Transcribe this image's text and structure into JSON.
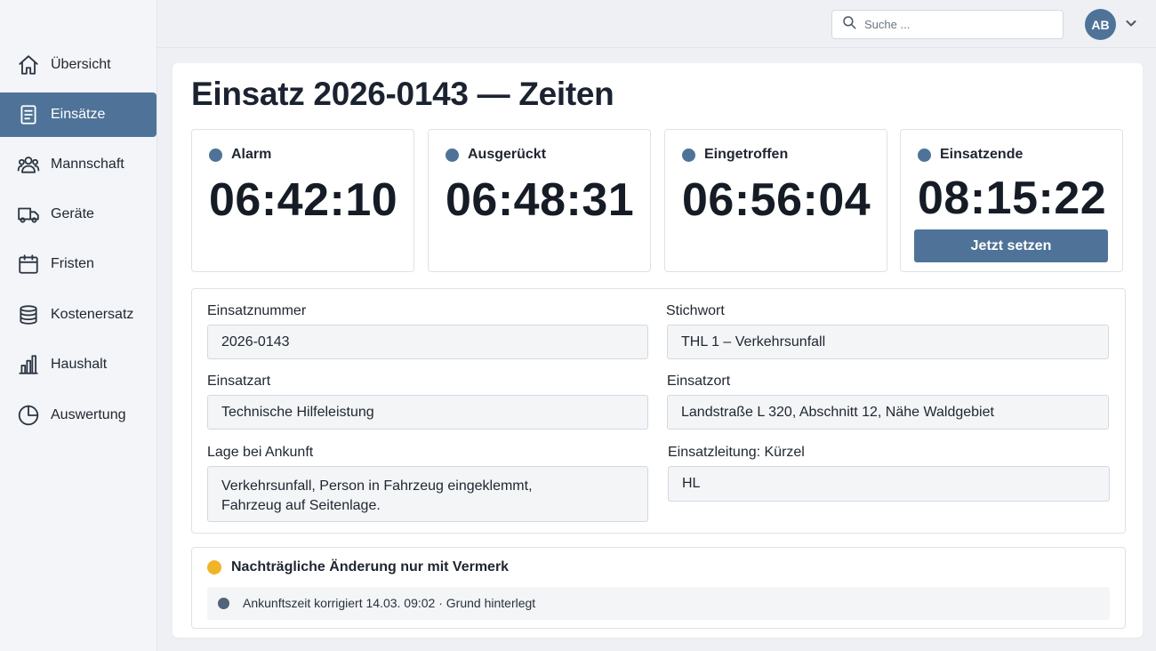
{
  "sidebar": {
    "items": [
      {
        "label": "Übersicht",
        "icon": "home-icon",
        "active": false
      },
      {
        "label": "Einsätze",
        "icon": "document-icon",
        "active": true
      },
      {
        "label": "Mannschaft",
        "icon": "users-icon",
        "active": false
      },
      {
        "label": "Geräte",
        "icon": "truck-icon",
        "active": false
      },
      {
        "label": "Fristen",
        "icon": "calendar-icon",
        "active": false
      },
      {
        "label": "Kostenersatz",
        "icon": "coins-icon",
        "active": false
      },
      {
        "label": "Haushalt",
        "icon": "bar-chart-icon",
        "active": false
      },
      {
        "label": "Auswertung",
        "icon": "pie-chart-icon",
        "active": false
      }
    ]
  },
  "topbar": {
    "search_placeholder": "Suche ...",
    "avatar_initials": "AB"
  },
  "page": {
    "title": "Einsatz 2026-0143 — Zeiten"
  },
  "times": [
    {
      "label": "Alarm",
      "value": "06:42:10"
    },
    {
      "label": "Ausgerückt",
      "value": "06:48:31"
    },
    {
      "label": "Eingetroffen",
      "value": "06:56:04"
    },
    {
      "label": "Einsatzende",
      "value": "08:15:22"
    }
  ],
  "set_now_label": "Jetzt setzen",
  "form": {
    "einsatznummer": {
      "label": "Einsatznummer",
      "value": "2026-0143"
    },
    "stichwort": {
      "label": "Stichwort",
      "value": "THL 1 – Verkehrsunfall"
    },
    "einsatzart": {
      "label": "Einsatzart",
      "value": "Technische Hilfeleistung"
    },
    "einsatzort": {
      "label": "Einsatzort",
      "value": "Landstraße L 320, Abschnitt 12, Nähe Waldgebiet"
    },
    "lage": {
      "label": "Lage bei Ankunft",
      "value": "Verkehrsunfall, Person in Fahrzeug eingeklemmt,\nFahrzeug auf Seitenlage."
    },
    "einsatzleitung": {
      "label": "Einsatzleitung: Kürzel",
      "value": "HL"
    }
  },
  "note": {
    "title": "Nachträgliche Änderung nur mit Vermerk",
    "entry": "Ankunftszeit korrigiert 14.03. 09:02  ·  Grund hinterlegt"
  },
  "colors": {
    "accent": "#4f7398",
    "warning": "#f0b429"
  }
}
